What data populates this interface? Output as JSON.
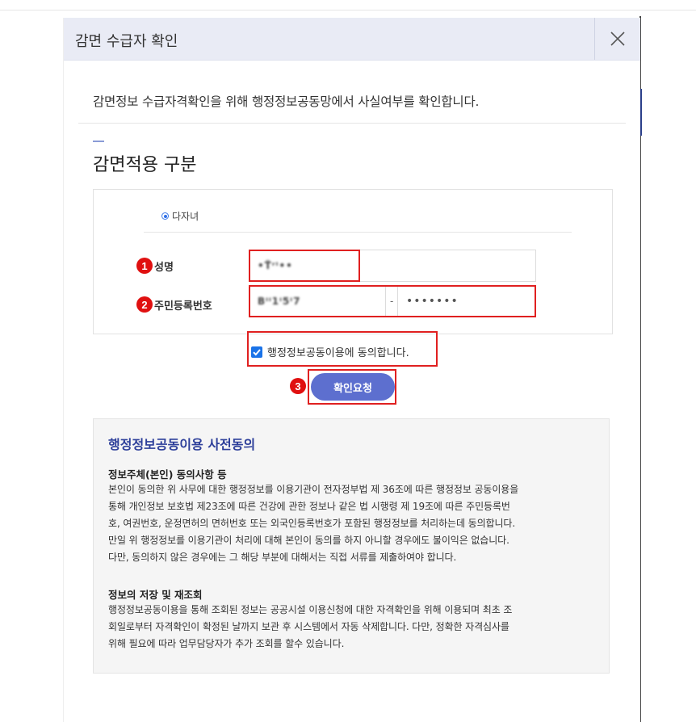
{
  "modal": {
    "title": "감면 수급자 확인",
    "intro": "감면정보 수급자격확인을 위해 행정정보공동망에서 사실여부를 확인합니다.",
    "section_title": "감면적용 구분"
  },
  "form": {
    "radio_option": "다자녀",
    "name_label": "성명",
    "rrn_label": "주민등록번호",
    "name_value": "•T̈ʳᴵ••",
    "rrn_front_value": "Bᴵᴵ1ᴵ5ᴵ7",
    "rrn_separator": "-",
    "rrn_back_value": "•••••••",
    "agree_label": "행정정보공동이용에 동의합니다.",
    "confirm_label": "확인요청",
    "badges": [
      "1",
      "2",
      "3"
    ]
  },
  "consent": {
    "title": "행정정보공동이용 사전동의",
    "section1_heading": "정보주체(본인) 동의사항 등",
    "section1_lines": [
      "본인이 동의한 위 사무에 대한 행정정보를 이용기관이 전자정부법 제 36조에 따른 행정정보 공동이용을",
      "통해 개인정보 보호법 제23조에 따른 건강에 관한 정보나 같은 법 시행령 제 19조에 따른 주민등록번",
      "호, 여권번호, 운정면허의 면허번호 또는 외국인등록번호가 포함된 행정정보를 처리하는데 동의합니다.",
      "만일 위 행정정보를 이용기관이 처리에 대해 본인이 동의를 하지 아니할 경우에도 불이익은 없습니다.",
      "다만, 동의하지 않은 경우에는 그 해당 부분에 대해서는 직접 서류를 제출하여야 합니다."
    ],
    "section2_heading": "정보의 저장 및 재조회",
    "section2_lines": [
      "행정정보공동이용을 통해 조회된 정보는 공공시설 이용신청에 대한 자격확인을 위해 이용되며 최초 조",
      "회일로부터 자격확인이 확정된 날까지 보관 후 시스템에서 자동 삭제합니다. 다만, 정확한 자격심사를",
      "위해 필요에 따라 업무담당자가 추가 조회를 할수 있습니다."
    ]
  },
  "colors": {
    "header_bg": "#e9ebf5",
    "accent_blue": "#2d3f9a",
    "button": "#5d6fcf",
    "highlight_red": "#e02020"
  }
}
